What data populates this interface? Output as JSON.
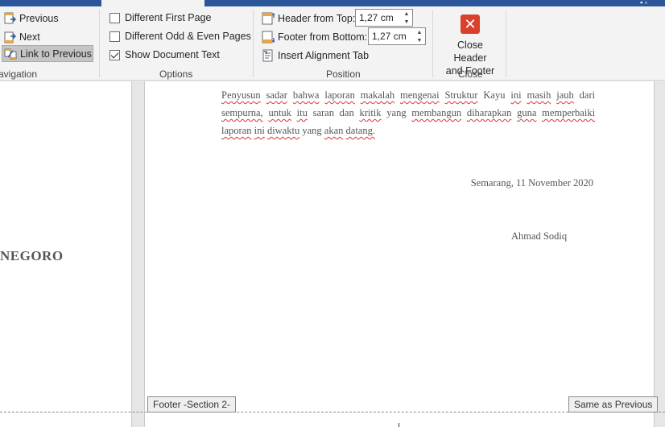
{
  "ribbon": {
    "navigation": {
      "previous_label": "Previous",
      "next_label": "Next",
      "link_to_previous_label": "Link to Previous",
      "group_label": "avigation"
    },
    "options": {
      "different_first_page": {
        "label": "Different First Page",
        "checked": false
      },
      "different_odd_even": {
        "label": "Different Odd & Even Pages",
        "checked": false
      },
      "show_document_text": {
        "label": "Show Document Text",
        "checked": true
      },
      "group_label": "Options"
    },
    "position": {
      "header_from_top_label": "Header from Top:",
      "header_from_top_value": "1,27 cm",
      "footer_from_bottom_label": "Footer from Bottom:",
      "footer_from_bottom_value": "1,27 cm",
      "insert_alignment_tab_label": "Insert Alignment Tab",
      "group_label": "Position"
    },
    "close": {
      "close_line1": "Close Header",
      "close_line2": "and Footer",
      "group_label": "Close"
    }
  },
  "document": {
    "left_page_text": "NEGORO",
    "paragraph_words": [
      "Penyusun",
      "sadar",
      "bahwa",
      "laporan",
      "makalah",
      "mengenai",
      "Struktur",
      "Kayu",
      "ini",
      "masih",
      "jauh",
      "dari",
      "sempurna,",
      "untuk",
      "itu",
      "saran",
      "dan",
      "kritik",
      "yang",
      "membangun",
      "diharapkan",
      "guna",
      "memperbaiki",
      "laporan",
      "ini",
      "diwaktu",
      "yang",
      "akan",
      "datang."
    ],
    "squiggly_indices": [
      0,
      1,
      2,
      3,
      4,
      5,
      6,
      8,
      9,
      10,
      12,
      13,
      14,
      17,
      19,
      20,
      21,
      22,
      23,
      24,
      25,
      27,
      28
    ],
    "date_line": "Semarang, 11 November 2020",
    "author": "Ahmad Sodiq",
    "footer_tag": "Footer -Section 2-",
    "same_as_previous": "Same as Previous"
  },
  "colors": {
    "title_bar": "#2b579a",
    "ribbon_bg": "#f3f3f3",
    "close_red": "#d9412e",
    "spell_underline": "#dd3333"
  }
}
